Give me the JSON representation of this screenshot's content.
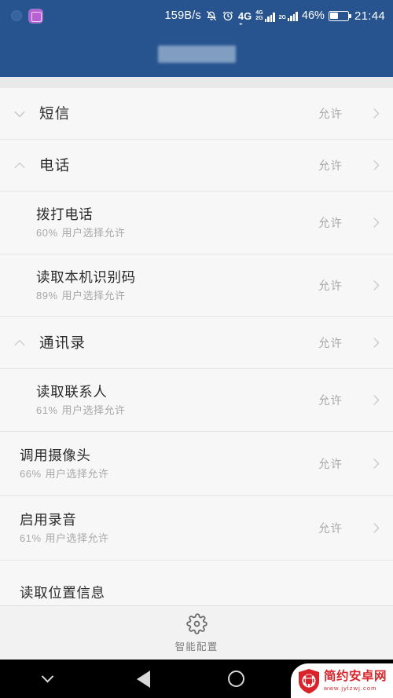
{
  "status_bar": {
    "net_speed": "159B/s",
    "battery_percent": "46%",
    "battery_level": 46,
    "clock": "21:44",
    "net_type_primary": "4G",
    "sim1_labels": [
      "4G",
      "2G"
    ],
    "sim2_label": "2G",
    "icons": [
      "weather-dot-icon",
      "purple-app-icon",
      "mute-bell-icon",
      "alarm-clock-icon",
      "signal-bars-icon",
      "battery-icon"
    ],
    "background_color": "#27548f"
  },
  "header": {
    "title_redacted": true,
    "background_color": "#27548f"
  },
  "permissions": [
    {
      "name": "短信",
      "type": "group",
      "expanded": false,
      "toggle_icon": "chevron-down-icon",
      "value": "允许",
      "arrow_icon": "chevron-right-icon"
    },
    {
      "name": "电话",
      "type": "group",
      "expanded": true,
      "toggle_icon": "chevron-up-icon",
      "value": "允许",
      "arrow_icon": "chevron-right-icon"
    },
    {
      "name": "拨打电话",
      "type": "sub",
      "percent": "60%",
      "sub_text": "用户选择允许",
      "value": "允许",
      "arrow_icon": "chevron-right-icon"
    },
    {
      "name": "读取本机识别码",
      "type": "sub",
      "percent": "89%",
      "sub_text": "用户选择允许",
      "value": "允许",
      "arrow_icon": "chevron-right-icon"
    },
    {
      "name": "通讯录",
      "type": "group",
      "expanded": true,
      "toggle_icon": "chevron-up-icon",
      "value": "允许",
      "arrow_icon": "chevron-right-icon"
    },
    {
      "name": "读取联系人",
      "type": "sub",
      "percent": "61%",
      "sub_text": "用户选择允许",
      "value": "允许",
      "arrow_icon": "chevron-right-icon"
    },
    {
      "name": "调用摄像头",
      "type": "plain",
      "percent": "66%",
      "sub_text": "用户选择允许",
      "value": "允许",
      "arrow_icon": "chevron-right-icon"
    },
    {
      "name": "启用录音",
      "type": "plain",
      "percent": "61%",
      "sub_text": "用户选择允许",
      "value": "允许",
      "arrow_icon": "chevron-right-icon"
    },
    {
      "name": "读取位置信息",
      "type": "cut",
      "percent": "",
      "sub_text": "",
      "value": "",
      "arrow_icon": ""
    }
  ],
  "bottom_bar": {
    "label": "智能配置",
    "icon": "gear-icon"
  },
  "nav_bar": {
    "hide_icon": "chevron-down-icon",
    "back_icon": "back-triangle-icon",
    "home_icon": "home-circle-icon",
    "recents_icon": "recents-square-icon",
    "background_color": "#000000"
  },
  "watermark": {
    "site_name": "简约安卓网",
    "url": "www.jylzwj.com",
    "logo_icon": "android-shield-icon",
    "brand_color": "#d8232a"
  }
}
